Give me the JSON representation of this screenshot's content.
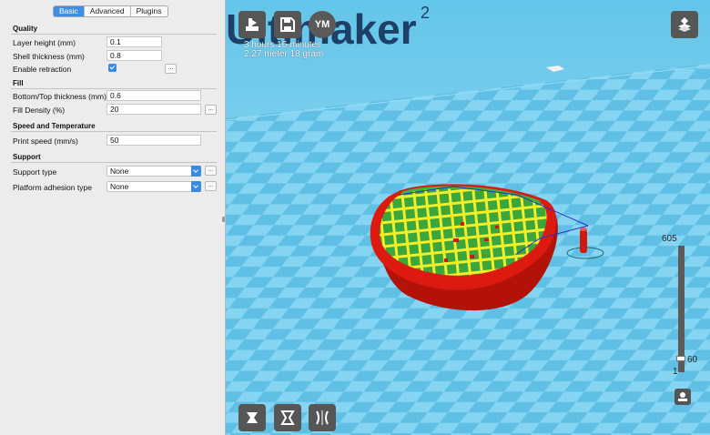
{
  "tabs": [
    {
      "label": "Basic",
      "active": true
    },
    {
      "label": "Advanced",
      "active": false
    },
    {
      "label": "Plugins",
      "active": false
    }
  ],
  "sections": {
    "quality": {
      "title": "Quality",
      "layer_height": {
        "label": "Layer height (mm)",
        "value": "0.1"
      },
      "shell_thickness": {
        "label": "Shell thickness (mm)",
        "value": "0.8"
      },
      "enable_retraction": {
        "label": "Enable retraction",
        "checked": true
      }
    },
    "fill": {
      "title": "Fill",
      "bottom_top_thickness": {
        "label": "Bottom/Top thickness (mm)",
        "value": "0.6"
      },
      "fill_density": {
        "label": "Fill Density (%)",
        "value": "20"
      }
    },
    "speed": {
      "title": "Speed and Temperature",
      "print_speed": {
        "label": "Print speed (mm/s)",
        "value": "50"
      }
    },
    "support": {
      "title": "Support",
      "support_type": {
        "label": "Support type",
        "value": "None"
      },
      "platform_adhesion": {
        "label": "Platform adhesion type",
        "value": "None"
      }
    }
  },
  "more_button_label": "...",
  "viewport": {
    "watermark": "Ultimaker",
    "watermark_sup": "2",
    "print_time": "3 hours 16 minutes",
    "print_material": "2.27 meter 18 gram",
    "ym_badge": "YM",
    "layer_max": "605",
    "layer_current": "60",
    "layer_min": "1"
  },
  "colors": {
    "accent": "#3d8ee6",
    "floor_light": "#84d4f2",
    "floor_dark": "#5fbfe4",
    "model_shell": "#dd1a0f",
    "model_infill": "#f2ee2a",
    "model_inner": "#3fb23c"
  },
  "icons": [
    "load-model-icon",
    "save-icon",
    "view-mode-icon",
    "rotate-icon",
    "scale-icon",
    "mirror-icon",
    "layer-view-icon"
  ]
}
